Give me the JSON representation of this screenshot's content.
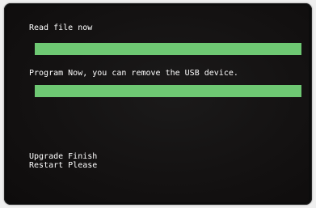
{
  "screen": {
    "read_status": "Read file now",
    "program_status": "Program Now, you can remove the USB device.",
    "finish_line1": "Upgrade Finish",
    "finish_line2": "Restart Please"
  },
  "progress": {
    "read_percent": 100,
    "program_percent": 100
  },
  "colors": {
    "background": "#141212",
    "text": "#ffffff",
    "progress_fill": "#6ec873"
  }
}
